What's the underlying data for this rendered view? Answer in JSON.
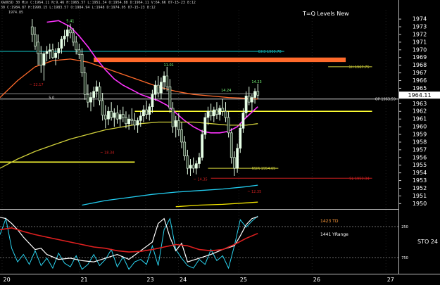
{
  "window": {
    "header_line1": "XAUUSD 30 Min  C:1964.11 N:9.46 H:1965.57 L:1951.34 O:1954.88 D:1964.11 V:64.6K  07-15-23 8:12",
    "header_line2": "30 C:1984.87 H:1990.15 L:1983.57 O:1984.94 L:1948 D:1974.05 07-15-23 8:12",
    "header_line3": "1974.85",
    "title": "T=Q Levels New"
  },
  "colors": {
    "background": "#000000",
    "candle": "#e6ffe6",
    "candle_dark": "#2a3a2a",
    "cyan_level": "#12c6c6",
    "orange_band": "#ff6a2b",
    "yellow_level": "#ffff33",
    "magenta_ma": "#ff33ff",
    "orange_ma": "#e07a2a",
    "olive_ma": "#cfcf3a",
    "lower_cyan": "#22cdf0",
    "lower_yellow": "#f2e400",
    "red_level": "#d02020",
    "osc_cyan": "#2ad4f0",
    "osc_red": "#e02020",
    "osc_white": "#ffffff",
    "grid_grey": "#6b6b6b"
  },
  "chart_data": {
    "type": "candlestick",
    "title": "T=Q Levels New",
    "price_axis": {
      "ticks": [
        1974,
        1973,
        1972,
        1971,
        1970,
        1969,
        1968,
        1967,
        1966,
        1965,
        1964,
        1963,
        1962,
        1961,
        1960,
        1959,
        1958,
        1957,
        1956,
        1955,
        1954,
        1953,
        1952,
        1951,
        1950
      ],
      "ylim": [
        1949.3,
        1975.2
      ],
      "current_price": "1964.11"
    },
    "x_axis": {
      "labels": [
        "20",
        "21",
        "23",
        "24",
        "25",
        "26",
        "27"
      ],
      "label_positions": [
        0.3,
        13.5,
        24.8,
        30.4,
        40.7,
        53.2,
        65.8
      ],
      "xlim": [
        0,
        68
      ]
    },
    "levels": [
      {
        "kind": "line",
        "price": 1969.8,
        "x0": 0,
        "x1": 48.5,
        "color": "cyan",
        "label": "GH3 1969.78"
      },
      {
        "kind": "band",
        "price_top": 1969.0,
        "price_bottom": 1968.6,
        "x0": 16,
        "x1": 59,
        "color": "orange"
      },
      {
        "kind": "line",
        "price": 1967.8,
        "x0": 56,
        "x1": 63.5,
        "color": "olive",
        "label": "1H 1967.75"
      },
      {
        "kind": "line",
        "price": 1963.6,
        "x0": 0,
        "x1": 68,
        "color": "white",
        "label": "OP 1963.59"
      },
      {
        "kind": "line",
        "price": 1964.3,
        "x0": 0,
        "x1": 44,
        "color": "grey",
        "label": ""
      },
      {
        "kind": "line",
        "price": 1962.0,
        "x0": 23,
        "x1": 63.5,
        "color": "yellow",
        "label": ""
      },
      {
        "kind": "line",
        "price": 1955.4,
        "x0": 0,
        "x1": 23,
        "color": "yellow",
        "label": ""
      },
      {
        "kind": "line",
        "price": 1954.6,
        "x0": 35.5,
        "x1": 47.5,
        "color": "olive",
        "label": "RSIR 1954.65"
      },
      {
        "kind": "line",
        "price": 1953.3,
        "x0": 36,
        "x1": 63.5,
        "color": "red",
        "label": "SL 1953.34"
      }
    ],
    "annotations": [
      {
        "text": "~ 22.17",
        "x": 6.2,
        "price": 1965.3,
        "color": "red"
      },
      {
        "text": "~ 18.34",
        "x": 18.3,
        "price": 1956.5,
        "color": "red"
      },
      {
        "text": "~ 14.35",
        "x": 34.2,
        "price": 1953.0,
        "color": "red"
      },
      {
        "text": "~ 12.35",
        "x": 43.4,
        "price": 1951.4,
        "color": "red"
      },
      {
        "text": "11.01",
        "x": 28.8,
        "price": 1967.9,
        "color": "green"
      },
      {
        "text": "14.23",
        "x": 43.8,
        "price": 1965.7,
        "color": "green"
      },
      {
        "text": "14.24",
        "x": 38.6,
        "price": 1964.6,
        "color": "green"
      },
      {
        "text": "5.41",
        "x": 12.0,
        "price": 1973.6,
        "color": "green"
      },
      {
        "text": "5.0",
        "x": 8.8,
        "price": 1963.6,
        "color": "white"
      }
    ],
    "candles": [
      {
        "x": 5.5,
        "o": 1973,
        "h": 1974,
        "l": 1971,
        "c": 1972
      },
      {
        "x": 6.0,
        "o": 1972,
        "h": 1973,
        "l": 1970,
        "c": 1970.5
      },
      {
        "x": 6.5,
        "o": 1971,
        "h": 1972,
        "l": 1968,
        "c": 1969.5
      },
      {
        "x": 7.0,
        "o": 1969.5,
        "h": 1970.5,
        "l": 1967,
        "c": 1968
      },
      {
        "x": 7.5,
        "o": 1968,
        "h": 1969.8,
        "l": 1966,
        "c": 1969.5
      },
      {
        "x": 8.0,
        "o": 1969.5,
        "h": 1970.5,
        "l": 1968.5,
        "c": 1969.8
      },
      {
        "x": 8.5,
        "o": 1969.8,
        "h": 1970.8,
        "l": 1968.8,
        "c": 1970
      },
      {
        "x": 9.0,
        "o": 1970,
        "h": 1970.8,
        "l": 1968.8,
        "c": 1969
      },
      {
        "x": 9.5,
        "o": 1969,
        "h": 1970.2,
        "l": 1968,
        "c": 1969.6
      },
      {
        "x": 10.0,
        "o": 1969.6,
        "h": 1971,
        "l": 1968.8,
        "c": 1970.2
      },
      {
        "x": 10.5,
        "o": 1970.2,
        "h": 1971.8,
        "l": 1969.5,
        "c": 1971.4
      },
      {
        "x": 11.0,
        "o": 1971.4,
        "h": 1972.6,
        "l": 1970.5,
        "c": 1971.8
      },
      {
        "x": 11.5,
        "o": 1971.8,
        "h": 1973.2,
        "l": 1971,
        "c": 1972.6
      },
      {
        "x": 12.0,
        "o": 1972.6,
        "h": 1973.4,
        "l": 1971.5,
        "c": 1972.2
      },
      {
        "x": 12.5,
        "o": 1972.2,
        "h": 1972.8,
        "l": 1970.5,
        "c": 1971
      },
      {
        "x": 13.0,
        "o": 1971,
        "h": 1971.8,
        "l": 1969.4,
        "c": 1970
      },
      {
        "x": 13.5,
        "o": 1970,
        "h": 1970.8,
        "l": 1968.8,
        "c": 1969.4
      },
      {
        "x": 14.0,
        "o": 1969.4,
        "h": 1970.2,
        "l": 1966.5,
        "c": 1967
      },
      {
        "x": 14.5,
        "o": 1967,
        "h": 1967.8,
        "l": 1963.5,
        "c": 1964.2
      },
      {
        "x": 15.0,
        "o": 1964.2,
        "h": 1965.5,
        "l": 1962.5,
        "c": 1963.2
      },
      {
        "x": 15.5,
        "o": 1963.2,
        "h": 1964.5,
        "l": 1962,
        "c": 1963.8
      },
      {
        "x": 16.0,
        "o": 1963.8,
        "h": 1965.2,
        "l": 1962.6,
        "c": 1964.6
      },
      {
        "x": 16.5,
        "o": 1964.6,
        "h": 1966,
        "l": 1963.8,
        "c": 1965.2
      },
      {
        "x": 17.0,
        "o": 1965.2,
        "h": 1965.8,
        "l": 1962.8,
        "c": 1963.4
      },
      {
        "x": 17.5,
        "o": 1963.4,
        "h": 1964.4,
        "l": 1960.8,
        "c": 1961.5
      },
      {
        "x": 18.0,
        "o": 1961.5,
        "h": 1962.8,
        "l": 1959.8,
        "c": 1961
      },
      {
        "x": 18.5,
        "o": 1961,
        "h": 1962.6,
        "l": 1960.2,
        "c": 1962
      },
      {
        "x": 19.0,
        "o": 1962,
        "h": 1963.2,
        "l": 1960.8,
        "c": 1961.2
      },
      {
        "x": 19.5,
        "o": 1961.2,
        "h": 1962.4,
        "l": 1960,
        "c": 1961.8
      },
      {
        "x": 20.0,
        "o": 1961.8,
        "h": 1962.8,
        "l": 1960.4,
        "c": 1961
      },
      {
        "x": 20.5,
        "o": 1961,
        "h": 1962.2,
        "l": 1960,
        "c": 1961.6
      },
      {
        "x": 21.0,
        "o": 1961.6,
        "h": 1962.6,
        "l": 1960.6,
        "c": 1961.2
      },
      {
        "x": 21.5,
        "o": 1961.2,
        "h": 1962,
        "l": 1959.8,
        "c": 1960.4
      },
      {
        "x": 22.0,
        "o": 1960.4,
        "h": 1961.6,
        "l": 1959.6,
        "c": 1961
      },
      {
        "x": 22.5,
        "o": 1961,
        "h": 1962.4,
        "l": 1960.2,
        "c": 1960.8
      },
      {
        "x": 23.0,
        "o": 1960.8,
        "h": 1961.8,
        "l": 1959.6,
        "c": 1960.2
      },
      {
        "x": 23.5,
        "o": 1960.2,
        "h": 1961.2,
        "l": 1959.2,
        "c": 1960.8
      },
      {
        "x": 24.0,
        "o": 1960.8,
        "h": 1962,
        "l": 1960,
        "c": 1961.4
      },
      {
        "x": 24.5,
        "o": 1961.4,
        "h": 1962.8,
        "l": 1960.6,
        "c": 1962.2
      },
      {
        "x": 25.0,
        "o": 1962.2,
        "h": 1963.4,
        "l": 1961,
        "c": 1961.6
      },
      {
        "x": 25.5,
        "o": 1961.6,
        "h": 1963,
        "l": 1960.8,
        "c": 1962.6
      },
      {
        "x": 26.0,
        "o": 1962.6,
        "h": 1964.8,
        "l": 1961.8,
        "c": 1964.2
      },
      {
        "x": 26.5,
        "o": 1964.2,
        "h": 1966,
        "l": 1963.4,
        "c": 1965.4
      },
      {
        "x": 27.0,
        "o": 1965.4,
        "h": 1966.6,
        "l": 1963.8,
        "c": 1964.4
      },
      {
        "x": 27.5,
        "o": 1964.4,
        "h": 1966.4,
        "l": 1963.6,
        "c": 1965.8
      },
      {
        "x": 28.0,
        "o": 1965.8,
        "h": 1967.2,
        "l": 1964.8,
        "c": 1966.6
      },
      {
        "x": 28.5,
        "o": 1966.6,
        "h": 1967.8,
        "l": 1964.6,
        "c": 1965.2
      },
      {
        "x": 29.0,
        "o": 1965.2,
        "h": 1966.2,
        "l": 1961.8,
        "c": 1962.4
      },
      {
        "x": 29.5,
        "o": 1962.4,
        "h": 1963.2,
        "l": 1959.2,
        "c": 1960
      },
      {
        "x": 30.0,
        "o": 1960,
        "h": 1961.4,
        "l": 1958.6,
        "c": 1960.8
      },
      {
        "x": 30.5,
        "o": 1960.8,
        "h": 1961.8,
        "l": 1958.8,
        "c": 1959.6
      },
      {
        "x": 31.0,
        "o": 1959.6,
        "h": 1960.6,
        "l": 1957.2,
        "c": 1958
      },
      {
        "x": 31.5,
        "o": 1958,
        "h": 1958.8,
        "l": 1955.6,
        "c": 1956.2
      },
      {
        "x": 32.0,
        "o": 1956.2,
        "h": 1957,
        "l": 1953.8,
        "c": 1954.6
      },
      {
        "x": 32.5,
        "o": 1954.6,
        "h": 1955.8,
        "l": 1953.6,
        "c": 1955
      },
      {
        "x": 33.0,
        "o": 1955,
        "h": 1956,
        "l": 1954,
        "c": 1954.6
      },
      {
        "x": 33.5,
        "o": 1954.6,
        "h": 1955.6,
        "l": 1953.8,
        "c": 1955.2
      },
      {
        "x": 34.0,
        "o": 1955.2,
        "h": 1956.6,
        "l": 1954.6,
        "c": 1956
      },
      {
        "x": 34.5,
        "o": 1956,
        "h": 1959.6,
        "l": 1955.6,
        "c": 1959
      },
      {
        "x": 35.0,
        "o": 1959,
        "h": 1961.8,
        "l": 1958.4,
        "c": 1961.2
      },
      {
        "x": 35.5,
        "o": 1961.2,
        "h": 1962.6,
        "l": 1960.2,
        "c": 1962
      },
      {
        "x": 36.0,
        "o": 1962,
        "h": 1963,
        "l": 1960.8,
        "c": 1961.4
      },
      {
        "x": 36.5,
        "o": 1961.4,
        "h": 1962.6,
        "l": 1960.6,
        "c": 1962.2
      },
      {
        "x": 37.0,
        "o": 1962.2,
        "h": 1963.2,
        "l": 1961,
        "c": 1961.6
      },
      {
        "x": 37.5,
        "o": 1961.6,
        "h": 1962.8,
        "l": 1960.8,
        "c": 1962.4
      },
      {
        "x": 38.0,
        "o": 1962.4,
        "h": 1963.6,
        "l": 1961.4,
        "c": 1962
      },
      {
        "x": 38.5,
        "o": 1962,
        "h": 1963.2,
        "l": 1960.6,
        "c": 1961.2
      },
      {
        "x": 39.0,
        "o": 1961.2,
        "h": 1962,
        "l": 1958.6,
        "c": 1959.2
      },
      {
        "x": 39.5,
        "o": 1959.2,
        "h": 1959.8,
        "l": 1955.2,
        "c": 1956
      },
      {
        "x": 40.0,
        "o": 1956,
        "h": 1956.8,
        "l": 1953.6,
        "c": 1954.6
      },
      {
        "x": 40.5,
        "o": 1954.6,
        "h": 1957.8,
        "l": 1954,
        "c": 1957.2
      },
      {
        "x": 41.0,
        "o": 1957.2,
        "h": 1960.4,
        "l": 1956.6,
        "c": 1959.8
      },
      {
        "x": 41.5,
        "o": 1959.8,
        "h": 1962.4,
        "l": 1959.2,
        "c": 1961.8
      },
      {
        "x": 42.0,
        "o": 1961.8,
        "h": 1964.6,
        "l": 1961.2,
        "c": 1964
      },
      {
        "x": 42.5,
        "o": 1964,
        "h": 1965.2,
        "l": 1962.8,
        "c": 1963.2
      },
      {
        "x": 43.0,
        "o": 1963.2,
        "h": 1964.2,
        "l": 1962,
        "c": 1963.8
      },
      {
        "x": 43.5,
        "o": 1963.8,
        "h": 1965,
        "l": 1963,
        "c": 1964.6
      },
      {
        "x": 44.0,
        "o": 1964.6,
        "h": 1965.6,
        "l": 1963.6,
        "c": 1964.1
      }
    ],
    "moving_averages": [
      {
        "name": "",
        "color": "magenta",
        "x": [
          8,
          10,
          12,
          13.5,
          15,
          16.5,
          18,
          19.5,
          21,
          22.5,
          24,
          25.5,
          27,
          28.5,
          30,
          31.5,
          33,
          34.5,
          36,
          37.5,
          39,
          40.5,
          42,
          44
        ],
        "y": [
          1973.6,
          1973.8,
          1973,
          1971.8,
          1970.4,
          1968.8,
          1967.4,
          1966.2,
          1965.4,
          1964.8,
          1964.2,
          1963.8,
          1963.4,
          1962.8,
          1961.8,
          1960.8,
          1960,
          1959.4,
          1959.2,
          1959.2,
          1959.4,
          1960,
          1961.2,
          1962.6
        ]
      },
      {
        "name": "",
        "color": "orange",
        "x": [
          0,
          3,
          6,
          9,
          12,
          15,
          18,
          21,
          24,
          27,
          30,
          33,
          36,
          39,
          42,
          44
        ],
        "y": [
          1963.8,
          1966,
          1967.8,
          1968.6,
          1968.8,
          1968.4,
          1967.6,
          1966.8,
          1966,
          1965.2,
          1964.6,
          1964.2,
          1964,
          1963.8,
          1963.7,
          1963.6
        ]
      },
      {
        "name": "",
        "color": "olive",
        "x": [
          0,
          3,
          6,
          9,
          12,
          15,
          18,
          21,
          24,
          27,
          30,
          33,
          36,
          39,
          42,
          44
        ],
        "y": [
          1954.6,
          1955.8,
          1956.8,
          1957.6,
          1958.4,
          1959,
          1959.6,
          1960,
          1960.4,
          1960.6,
          1960.6,
          1960.6,
          1960.4,
          1960.2,
          1960.2,
          1960.4
        ]
      },
      {
        "name": "",
        "color": "lower_cyan",
        "x": [
          14,
          18,
          22,
          26,
          30,
          34,
          38,
          42,
          44
        ],
        "y": [
          1949.8,
          1950.4,
          1950.8,
          1951.2,
          1951.5,
          1951.7,
          1951.9,
          1952.2,
          1952.4
        ]
      },
      {
        "name": "",
        "color": "lower_yellow",
        "x": [
          30,
          34,
          38,
          42,
          44
        ],
        "y": [
          1949.6,
          1949.8,
          1949.9,
          1950.1,
          1950.2
        ]
      }
    ],
    "oscillator": {
      "ticks": [
        "250",
        "750"
      ],
      "tick_values": [
        250,
        750
      ],
      "ylim": [
        1000,
        0
      ],
      "label": "STO 24",
      "white": {
        "x": [
          0,
          1,
          2,
          3,
          4,
          5,
          6,
          7,
          8,
          10,
          12,
          14,
          16,
          18,
          20,
          22,
          24,
          26,
          27,
          28,
          29,
          30,
          31,
          32,
          34,
          36,
          38,
          40,
          41,
          42,
          43,
          44
        ],
        "y": [
          100,
          120,
          200,
          300,
          420,
          520,
          620,
          600,
          700,
          780,
          760,
          800,
          820,
          760,
          700,
          780,
          640,
          500,
          200,
          120,
          420,
          640,
          520,
          820,
          760,
          700,
          620,
          560,
          400,
          220,
          120,
          90
        ]
      },
      "cyan": {
        "x": [
          0,
          1,
          2,
          3,
          4,
          5,
          6,
          7,
          8,
          9,
          10,
          11,
          12,
          13,
          14,
          15,
          16,
          17,
          18,
          19,
          20,
          21,
          22,
          23,
          24,
          25,
          26,
          27,
          28,
          29,
          30,
          31,
          32,
          33,
          34,
          35,
          36,
          37,
          38,
          39,
          40,
          41,
          42,
          43,
          44
        ],
        "y": [
          380,
          120,
          600,
          820,
          700,
          860,
          640,
          880,
          760,
          920,
          680,
          840,
          900,
          720,
          940,
          860,
          700,
          880,
          780,
          620,
          900,
          740,
          940,
          820,
          780,
          860,
          560,
          880,
          300,
          120,
          620,
          760,
          880,
          920,
          780,
          860,
          620,
          800,
          720,
          920,
          560,
          140,
          260,
          160,
          80
        ]
      },
      "red": {
        "x": [
          0,
          2,
          4,
          6,
          8,
          10,
          12,
          14,
          16,
          18,
          20,
          22,
          24,
          26,
          28,
          30,
          32,
          34,
          36,
          38,
          40,
          42,
          44
        ],
        "y": [
          300,
          270,
          330,
          380,
          420,
          460,
          500,
          540,
          580,
          600,
          640,
          660,
          650,
          620,
          580,
          540,
          560,
          620,
          640,
          620,
          540,
          440,
          360
        ]
      }
    },
    "indicator_labels": [
      {
        "text": "1423 TD",
        "color": "orange"
      },
      {
        "text": "1441 YRange",
        "color": "white"
      }
    ]
  }
}
